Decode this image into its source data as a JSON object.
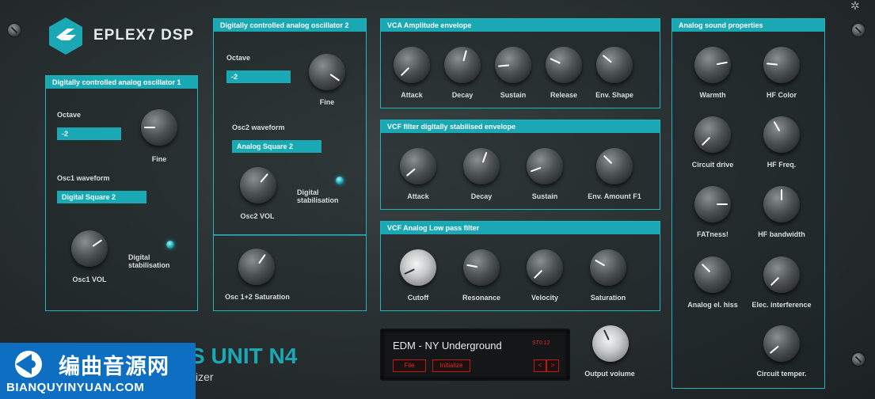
{
  "brand": {
    "name": "EPLEX7 DSP",
    "product_partial": "S UNIT N4",
    "subtitle_partial": "sizer"
  },
  "osc1": {
    "title": "Digitally controlled analog oscillator 1",
    "octave_label": "Octave",
    "octave_value": "-2",
    "fine_label": "Fine",
    "waveform_label": "Osc1 waveform",
    "waveform_value": "Digital Square 2",
    "vol_label": "Osc1 VOL",
    "stab_label_1": "Digital",
    "stab_label_2": "stabilisation"
  },
  "osc2": {
    "title": "Digitally controlled analog oscillator 2",
    "octave_label": "Octave",
    "octave_value": "-2",
    "fine_label": "Fine",
    "waveform_label": "Osc2 waveform",
    "waveform_value": "Analog Square 2",
    "vol_label": "Osc2 VOL",
    "stab_label_1": "Digital",
    "stab_label_2": "stabilisation"
  },
  "saturation_panel": {
    "label": "Osc 1+2 Saturation"
  },
  "vca": {
    "title": "VCA Amplitude envelope",
    "knobs": [
      "Attack",
      "Decay",
      "Sustain",
      "Release",
      "Env. Shape"
    ]
  },
  "vcf_env": {
    "title": "VCF filter digitally stabilised envelope",
    "knobs": [
      "Attack",
      "Decay",
      "Sustain",
      "Env. Amount F1"
    ]
  },
  "vcf_lp": {
    "title": "VCF Analog Low pass filter",
    "knobs": [
      "Cutoff",
      "Resonance",
      "Velocity",
      "Saturation"
    ]
  },
  "analog": {
    "title": "Analog sound properties",
    "knobs": [
      "Warmth",
      "HF Color",
      "Circuit drive",
      "HF Freq.",
      "FATness!",
      "HF bandwidth",
      "Analog el. hiss",
      "Elec. interference",
      "Circuit temper."
    ]
  },
  "display": {
    "preset": "EDM - NY Underground",
    "file_button": "File",
    "button2": "Initialize",
    "status": "ST0.12",
    "prev": "<",
    "next": ">"
  },
  "output": {
    "label": "Output volume"
  },
  "watermark": {
    "cn": "编曲音源网",
    "url": "BIANQUYINYUAN.COM"
  },
  "colors": {
    "accent": "#1aa9b4",
    "background": "#2a3133",
    "display_red": "#e02a2a",
    "watermark_blue": "#0e6fc2"
  }
}
